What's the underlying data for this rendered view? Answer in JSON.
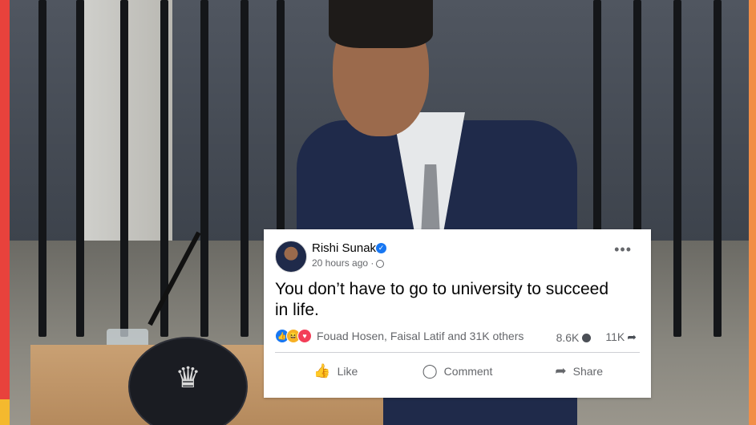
{
  "post": {
    "author": "Rishi Sunak",
    "time": "20 hours ago ·",
    "text": "You don’t have to go to university to succeed in life.",
    "reactions_text": "Fouad Hosen, Faisal Latif and 31K others",
    "comments_count": "8.6K",
    "shares_count": "11K",
    "actions": {
      "like": "Like",
      "comment": "Comment",
      "share": "Share"
    }
  },
  "icons": {
    "verified": "verified-badge-icon",
    "globe": "globe-icon",
    "more": "more-options-icon",
    "reactions": [
      "like-icon",
      "haha-icon",
      "love-icon"
    ]
  },
  "colors": {
    "left_stripe": "#e8423c",
    "left_stripe_bottom": "#f4b92e",
    "right_stripe": "#f28e47",
    "facebook_blue": "#1877f2"
  }
}
